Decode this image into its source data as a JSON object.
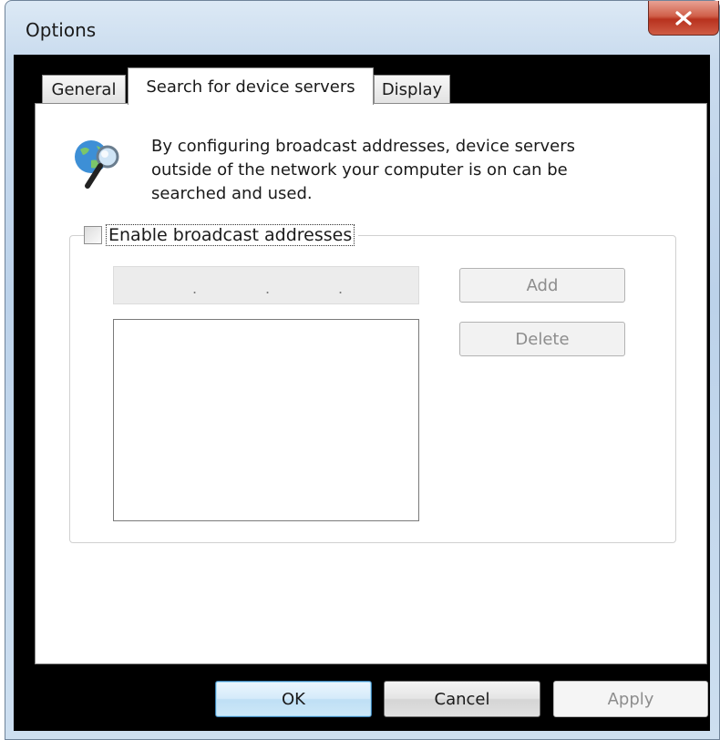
{
  "window": {
    "title": "Options",
    "close_icon": "close-x-icon"
  },
  "tabs": [
    {
      "label": "General",
      "active": false
    },
    {
      "label": "Search for device servers",
      "active": true
    },
    {
      "label": "Display",
      "active": false
    }
  ],
  "info": {
    "icon": "network-search-icon",
    "description": "By configuring broadcast addresses, device servers\noutside of the network your computer is on can be\nsearched and used."
  },
  "broadcast": {
    "checkbox_label": "Enable broadcast addresses",
    "checked": false,
    "ip_value": ". . .",
    "add_label": "Add",
    "delete_label": "Delete",
    "addresses": []
  },
  "footer": {
    "ok_label": "OK",
    "cancel_label": "Cancel",
    "apply_label": "Apply"
  }
}
